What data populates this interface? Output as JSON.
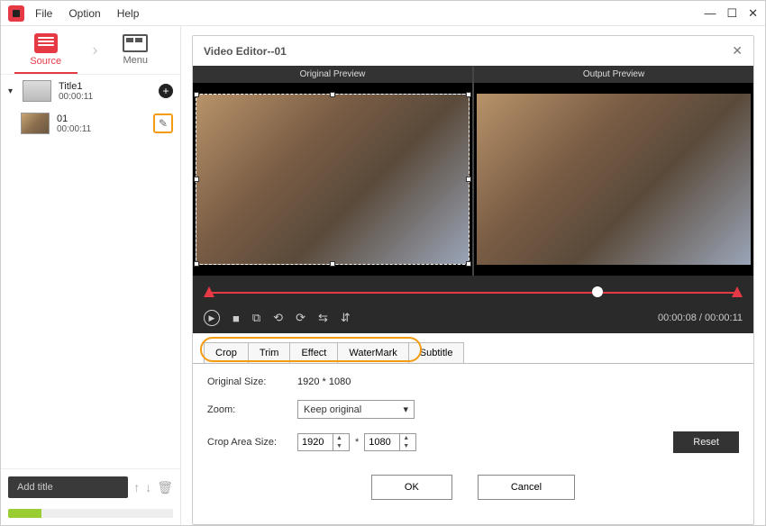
{
  "menu": {
    "file": "File",
    "option": "Option",
    "help": "Help"
  },
  "leftTabs": {
    "source": "Source",
    "menu": "Menu"
  },
  "items": {
    "title1": {
      "name": "Title1",
      "time": "00:00:11"
    },
    "clip1": {
      "name": "01",
      "time": "00:00:11"
    }
  },
  "addTitle": "Add title",
  "editor": {
    "title": "Video Editor--01",
    "previewOriginal": "Original Preview",
    "previewOutput": "Output Preview",
    "timecode": "00:00:08 / 00:00:11",
    "tabs": {
      "crop": "Crop",
      "trim": "Trim",
      "effect": "Effect",
      "watermark": "WaterMark",
      "subtitle": "Subtitle"
    },
    "labels": {
      "originalSize": "Original Size:",
      "zoom": "Zoom:",
      "cropArea": "Crop Area Size:"
    },
    "values": {
      "originalSize": "1920 * 1080",
      "zoom": "Keep original",
      "cropW": "1920",
      "cropH": "1080",
      "mult": "*"
    },
    "buttons": {
      "reset": "Reset",
      "ok": "OK",
      "cancel": "Cancel"
    }
  }
}
